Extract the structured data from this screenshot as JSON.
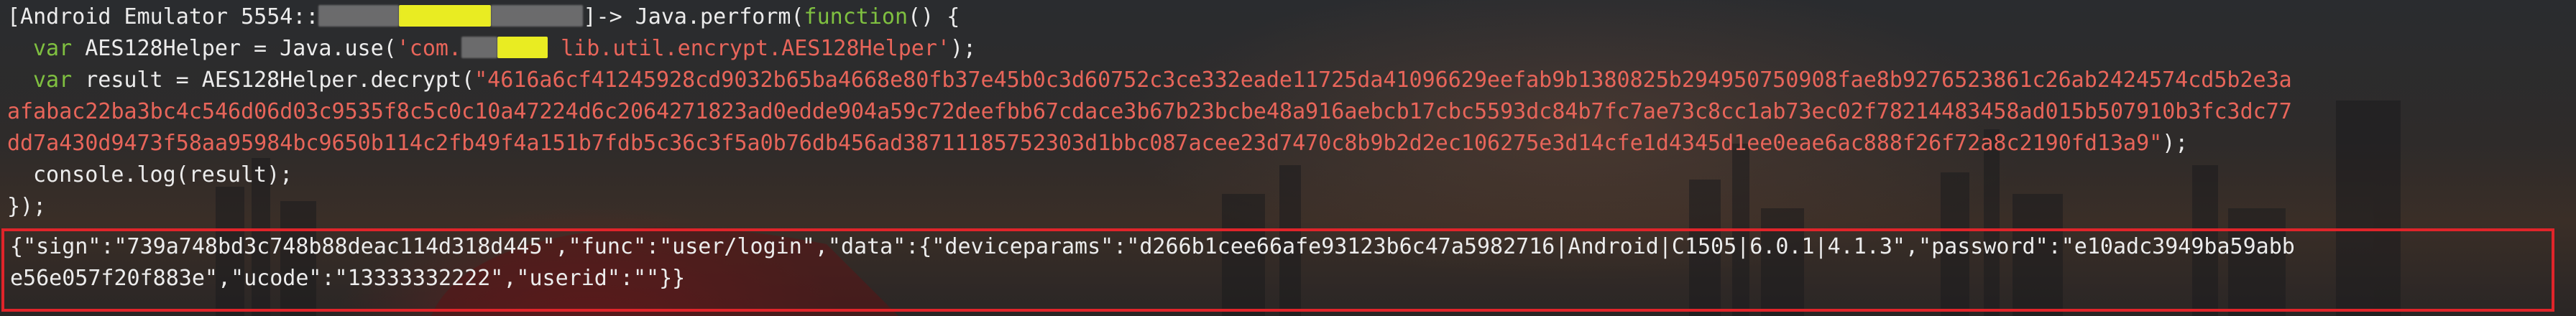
{
  "prompt": {
    "prefix": "[Android Emulator 5554::",
    "suffix": "]-> Java.perform(",
    "function_kw": "function",
    "after_function": "() {"
  },
  "code": {
    "line1_var": "var",
    "line1_text": " AES128Helper = Java.use(",
    "line1_str_a": "'com.",
    "line1_str_b": " lib.util.encrypt.AES128Helper'",
    "line1_end": ");",
    "line2_var": "var",
    "line2_text": " result = AES128Helper.decrypt(",
    "line2_str": "\"4616a6cf41245928cd9032b65ba4668e80fb37e45b0c3d60752c3ce332eade11725da41096629eefab9b1380825b294950750908fae8b9276523861c26ab2424574cd5b2e3a",
    "line3_str": "afabac22ba3bc4c546d06d03c9535f8c5c0c10a47224d6c2064271823ad0edde904a59c72deefbb67cdace3b67b23bcbe48a916aebcb17cbc5593dc84b7fc7ae73c8cc1ab73ec02f78214483458ad015b507910b3fc3dc77",
    "line4_str": "dd7a430d9473f58aa95984bc9650b114c2fb49f4a151b7fdb5c36c3f5a0b76db456ad38711185752303d1bbc087acee23d7470c8b9b2d2ec106275e3d14cfe1d4345d1ee0eae6ac888f26f72a8c2190fd13a9\"",
    "line4_end": ");",
    "line5_text": "console.log(result);",
    "line6_text": "});"
  },
  "output": {
    "line1": "{\"sign\":\"739a748bd3c748b88deac114d318d445\",\"func\":\"user/login\",\"data\":{\"deviceparams\":\"d266b1cee66afe93123b6c47a5982716|Android|C1505|6.0.1|4.1.3\",\"password\":\"e10adc3949ba59abb",
    "line2": "e56e057f20f883e\",\"ucode\":\"13333332222\",\"userid\":\"\"}}"
  },
  "colors": {
    "keyword": "#7fc040",
    "string": "#e8655a",
    "text": "#ececec",
    "highlight_border": "#e0242a",
    "redact_yellow": "#e9ec22"
  }
}
